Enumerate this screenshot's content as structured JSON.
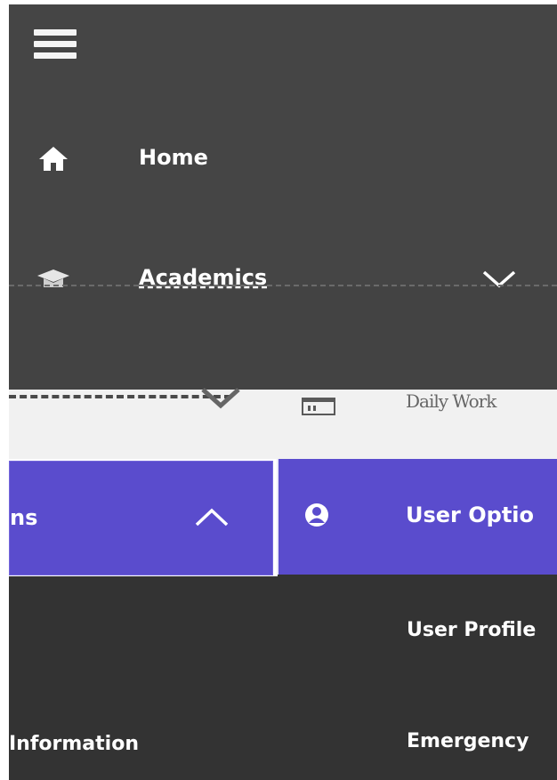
{
  "menu": {
    "items": [
      {
        "label": "Home",
        "icon": "home-icon"
      },
      {
        "label": "Academics",
        "icon": "graduation-cap-icon",
        "chevron": "chevron-down-icon"
      }
    ]
  },
  "strip": {
    "daily_label": "Daily Work"
  },
  "tiles": {
    "left": {
      "label": "ns"
    },
    "right": {
      "label": "User Optio",
      "icon": "user-circle-icon"
    }
  },
  "lower": {
    "left_item": "Information",
    "right_items": [
      "User Profile",
      "Emergency"
    ]
  },
  "colors": {
    "panel_dark": "#454545",
    "panel_darker": "#333333",
    "accent_purple": "#5a4ccd",
    "strip_bg": "#f1f1f1"
  }
}
